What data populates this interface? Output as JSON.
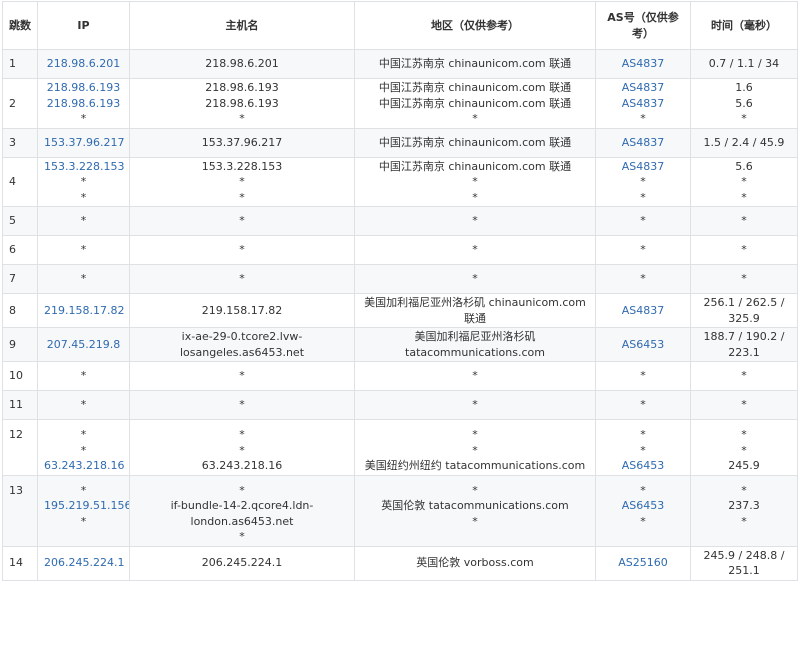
{
  "headers": {
    "hop": "跳数",
    "ip": "IP",
    "host": "主机名",
    "region": "地区（仅供参考）",
    "as": "AS号（仅供参考）",
    "time": "时间（毫秒）"
  },
  "rows": [
    {
      "hop": "1",
      "ip": [
        "218.98.6.201"
      ],
      "host": [
        "218.98.6.201"
      ],
      "region": [
        "中国江苏南京 chinaunicom.com 联通"
      ],
      "as": [
        "AS4837"
      ],
      "time": [
        "0.7 / 1.1 / 34"
      ]
    },
    {
      "hop": "2",
      "ip": [
        "218.98.6.193",
        "218.98.6.193",
        "*"
      ],
      "host": [
        "218.98.6.193",
        "218.98.6.193",
        "*"
      ],
      "region": [
        "中国江苏南京 chinaunicom.com 联通",
        "中国江苏南京 chinaunicom.com 联通",
        "*"
      ],
      "as": [
        "AS4837",
        "AS4837",
        "*"
      ],
      "time": [
        "1.6",
        "5.6",
        "*"
      ]
    },
    {
      "hop": "3",
      "ip": [
        "153.37.96.217"
      ],
      "host": [
        "153.37.96.217"
      ],
      "region": [
        "中国江苏南京 chinaunicom.com 联通"
      ],
      "as": [
        "AS4837"
      ],
      "time": [
        "1.5 / 2.4 / 45.9"
      ]
    },
    {
      "hop": "4",
      "ip": [
        "153.3.228.153",
        "*",
        "*"
      ],
      "host": [
        "153.3.228.153",
        "*",
        "*"
      ],
      "region": [
        "中国江苏南京 chinaunicom.com 联通",
        "*",
        "*"
      ],
      "as": [
        "AS4837",
        "*",
        "*"
      ],
      "time": [
        "5.6",
        "*",
        "*"
      ]
    },
    {
      "hop": "5",
      "ip": [
        "*"
      ],
      "host": [
        "*"
      ],
      "region": [
        "*"
      ],
      "as": [
        "*"
      ],
      "time": [
        "*"
      ]
    },
    {
      "hop": "6",
      "ip": [
        "*"
      ],
      "host": [
        "*"
      ],
      "region": [
        "*"
      ],
      "as": [
        "*"
      ],
      "time": [
        "*"
      ]
    },
    {
      "hop": "7",
      "ip": [
        "*"
      ],
      "host": [
        "*"
      ],
      "region": [
        "*"
      ],
      "as": [
        "*"
      ],
      "time": [
        "*"
      ]
    },
    {
      "hop": "8",
      "ip": [
        "219.158.17.82"
      ],
      "host": [
        "219.158.17.82"
      ],
      "region": [
        "美国加利福尼亚州洛杉矶 chinaunicom.com 联通"
      ],
      "as": [
        "AS4837"
      ],
      "time": [
        "256.1 / 262.5 / 325.9"
      ]
    },
    {
      "hop": "9",
      "ip": [
        "207.45.219.8"
      ],
      "host": [
        "ix-ae-29-0.tcore2.lvw-losangeles.as6453.net"
      ],
      "region": [
        "美国加利福尼亚州洛杉矶 tatacommunications.com"
      ],
      "as": [
        "AS6453"
      ],
      "time": [
        "188.7 / 190.2 / 223.1"
      ]
    },
    {
      "hop": "10",
      "ip": [
        "*"
      ],
      "host": [
        "*"
      ],
      "region": [
        "*"
      ],
      "as": [
        "*"
      ],
      "time": [
        "*"
      ]
    },
    {
      "hop": "11",
      "ip": [
        "*"
      ],
      "host": [
        "*"
      ],
      "region": [
        "*"
      ],
      "as": [
        "*"
      ],
      "time": [
        "*"
      ]
    },
    {
      "hop": "12",
      "ip": [
        "*",
        "*",
        "63.243.218.16"
      ],
      "host": [
        "*",
        "*",
        "63.243.218.16"
      ],
      "region": [
        "*",
        "*",
        "美国纽约州纽约 tatacommunications.com"
      ],
      "as": [
        "*",
        "*",
        "AS6453"
      ],
      "time": [
        "*",
        "*",
        "245.9"
      ]
    },
    {
      "hop": "13",
      "ip": [
        "*",
        "195.219.51.156",
        "*"
      ],
      "host": [
        "*",
        "if-bundle-14-2.qcore4.ldn-london.as6453.net",
        "*"
      ],
      "region": [
        "*",
        "英国伦敦 tatacommunications.com",
        "*"
      ],
      "as": [
        "*",
        "AS6453",
        "*"
      ],
      "time": [
        "*",
        "237.3",
        "*"
      ]
    },
    {
      "hop": "14",
      "ip": [
        "206.245.224.1"
      ],
      "host": [
        "206.245.224.1"
      ],
      "region": [
        "英国伦敦 vorboss.com"
      ],
      "as": [
        "AS25160"
      ],
      "time": [
        "245.9 / 248.8 / 251.1"
      ]
    }
  ]
}
